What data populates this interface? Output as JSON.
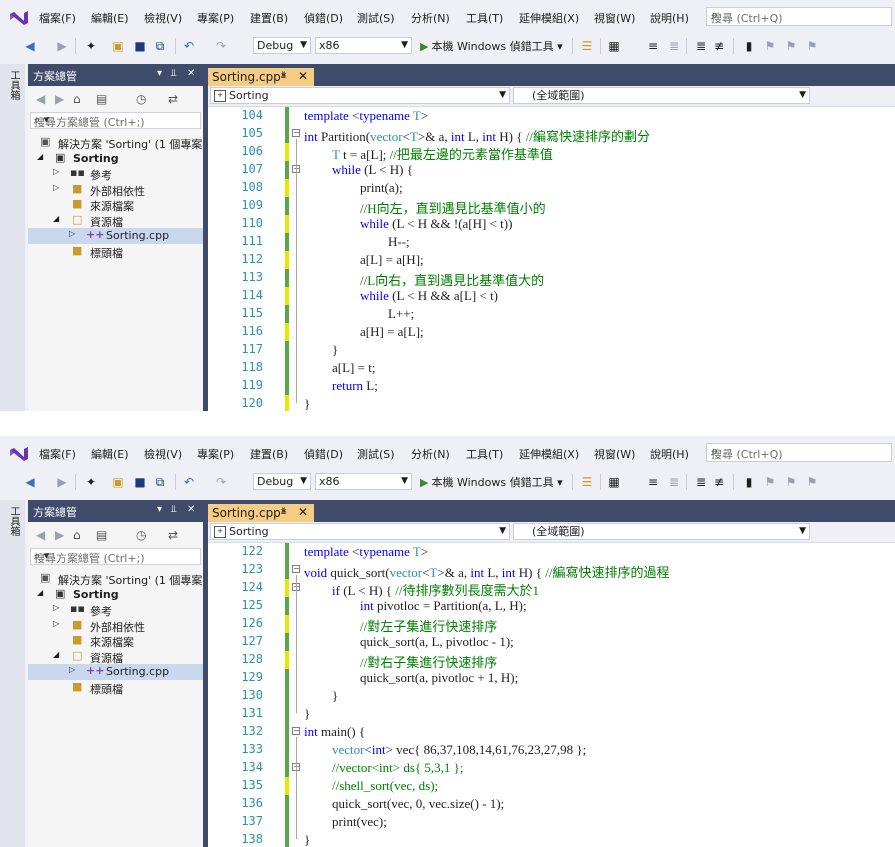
{
  "menu": [
    "檔案(F)",
    "編輯(E)",
    "檢視(V)",
    "專案(P)",
    "建置(B)",
    "偵錯(D)",
    "測試(S)",
    "分析(N)",
    "工具(T)",
    "延伸模組(X)",
    "視窗(W)",
    "說明(H)"
  ],
  "search_placeholder": "搜尋 (Ctrl+Q)",
  "toolbar": {
    "config": "Debug",
    "platform": "x86",
    "run_label": "本機 Windows 偵錯工具"
  },
  "toolstrip_label": "工具箱",
  "solution_explorer": {
    "title": "方案總管",
    "search_placeholder": "搜尋方案總管 (Ctrl+;)",
    "items": [
      "解決方案 'Sorting' (1 個專案，",
      "Sorting",
      "參考",
      "外部相依性",
      "來源檔案",
      "資源檔",
      "Sorting.cpp",
      "標頭檔"
    ]
  },
  "doc_tab": "Sorting.cpp*",
  "nav": {
    "file": "Sorting",
    "scope": "(全域範圍)"
  },
  "top": {
    "lines": [
      {
        "n": "104",
        "tokens": [
          [
            "kw",
            "template "
          ],
          [
            "",
            "<"
          ],
          [
            "kw",
            "typename "
          ],
          [
            "ty",
            "T"
          ],
          [
            "",
            ">"
          ]
        ]
      },
      {
        "n": "105",
        "tokens": [
          [
            "kw",
            "int "
          ],
          [
            "",
            "Partition("
          ],
          [
            "ty",
            "vector"
          ],
          [
            "",
            "<"
          ],
          [
            "ty",
            "T"
          ],
          [
            "",
            ">& a, "
          ],
          [
            "kw",
            "int "
          ],
          [
            "",
            "L, "
          ],
          [
            "kw",
            "int "
          ],
          [
            "",
            "H) { "
          ],
          [
            "cm",
            "//編寫快速排序的劃分"
          ]
        ]
      },
      {
        "n": "106",
        "tokens": [
          [
            "ty",
            "T "
          ],
          [
            "",
            "t = a[L]; "
          ],
          [
            "cm",
            "//把最左邊的元素當作基準值"
          ]
        ]
      },
      {
        "n": "107",
        "tokens": [
          [
            "kw",
            "while "
          ],
          [
            "",
            "(L < H) {"
          ]
        ]
      },
      {
        "n": "108",
        "tokens": [
          [
            "",
            "print(a);"
          ]
        ]
      },
      {
        "n": "109",
        "tokens": [
          [
            "cm",
            "//H向左，直到遇見比基準值小的"
          ]
        ]
      },
      {
        "n": "110",
        "tokens": [
          [
            "kw",
            "while "
          ],
          [
            "",
            "(L < H && !(a[H] < t))"
          ]
        ]
      },
      {
        "n": "111",
        "tokens": [
          [
            "",
            "H--;"
          ]
        ]
      },
      {
        "n": "112",
        "tokens": [
          [
            "",
            "a[L] = a[H];"
          ]
        ]
      },
      {
        "n": "113",
        "tokens": [
          [
            "cm",
            "//L向右，直到遇見比基準值大的"
          ]
        ]
      },
      {
        "n": "114",
        "tokens": [
          [
            "kw",
            "while "
          ],
          [
            "",
            "(L < H && a[L] < t)"
          ]
        ]
      },
      {
        "n": "115",
        "tokens": [
          [
            "",
            "L++;"
          ]
        ]
      },
      {
        "n": "116",
        "tokens": [
          [
            "",
            "a[H] = a[L];"
          ]
        ]
      },
      {
        "n": "117",
        "tokens": [
          [
            "",
            "}"
          ]
        ]
      },
      {
        "n": "118",
        "tokens": [
          [
            "",
            "a[L] = t;"
          ]
        ]
      },
      {
        "n": "119",
        "tokens": [
          [
            "kw",
            "return "
          ],
          [
            "",
            "L;"
          ]
        ]
      },
      {
        "n": "120",
        "tokens": [
          [
            "",
            "}"
          ]
        ]
      }
    ]
  },
  "bottom": {
    "lines": [
      {
        "n": "122",
        "tokens": [
          [
            "kw",
            "template "
          ],
          [
            "",
            "<"
          ],
          [
            "kw",
            "typename "
          ],
          [
            "ty",
            "T"
          ],
          [
            "",
            ">"
          ]
        ]
      },
      {
        "n": "123",
        "tokens": [
          [
            "kw",
            "void "
          ],
          [
            "",
            "quick_sort("
          ],
          [
            "ty",
            "vector"
          ],
          [
            "",
            "<"
          ],
          [
            "ty",
            "T"
          ],
          [
            "",
            ">& a, "
          ],
          [
            "kw",
            "int "
          ],
          [
            "",
            "L, "
          ],
          [
            "kw",
            "int "
          ],
          [
            "",
            "H) { "
          ],
          [
            "cm",
            "//編寫快速排序的過程"
          ]
        ]
      },
      {
        "n": "124",
        "tokens": [
          [
            "kw",
            "if "
          ],
          [
            "",
            "(L < H) { "
          ],
          [
            "cm",
            "//待排序數列長度需大於1"
          ]
        ]
      },
      {
        "n": "125",
        "tokens": [
          [
            "kw",
            "int "
          ],
          [
            "",
            "pivotloc = Partition(a, L, H);"
          ]
        ]
      },
      {
        "n": "126",
        "tokens": [
          [
            "cm",
            "//對左子集進行快速排序"
          ]
        ]
      },
      {
        "n": "127",
        "tokens": [
          [
            "",
            "quick_sort(a, L, pivotloc - 1);"
          ]
        ]
      },
      {
        "n": "128",
        "tokens": [
          [
            "cm",
            "//對右子集進行快速排序"
          ]
        ]
      },
      {
        "n": "129",
        "tokens": [
          [
            "",
            "quick_sort(a, pivotloc + 1, H);"
          ]
        ]
      },
      {
        "n": "130",
        "tokens": [
          [
            "",
            "}"
          ]
        ]
      },
      {
        "n": "131",
        "tokens": [
          [
            "",
            "}"
          ]
        ]
      },
      {
        "n": "132",
        "tokens": [
          [
            "kw",
            "int "
          ],
          [
            "",
            "main() {"
          ]
        ]
      },
      {
        "n": "133",
        "tokens": [
          [
            "ty",
            "vector"
          ],
          [
            "",
            "<"
          ],
          [
            "kw",
            "int"
          ],
          [
            "",
            "> vec{ 86,37,108,14,61,76,23,27,98 };"
          ]
        ]
      },
      {
        "n": "134",
        "tokens": [
          [
            "cm",
            "//vector<int> ds{ 5,3,1 };"
          ]
        ]
      },
      {
        "n": "135",
        "tokens": [
          [
            "cm",
            "//shell_sort(vec, ds);"
          ]
        ]
      },
      {
        "n": "136",
        "tokens": [
          [
            "",
            "quick_sort(vec, 0, vec.size() - 1);"
          ]
        ]
      },
      {
        "n": "137",
        "tokens": [
          [
            "",
            "print(vec);"
          ]
        ]
      },
      {
        "n": "138",
        "tokens": [
          [
            "",
            "}"
          ]
        ]
      }
    ]
  }
}
